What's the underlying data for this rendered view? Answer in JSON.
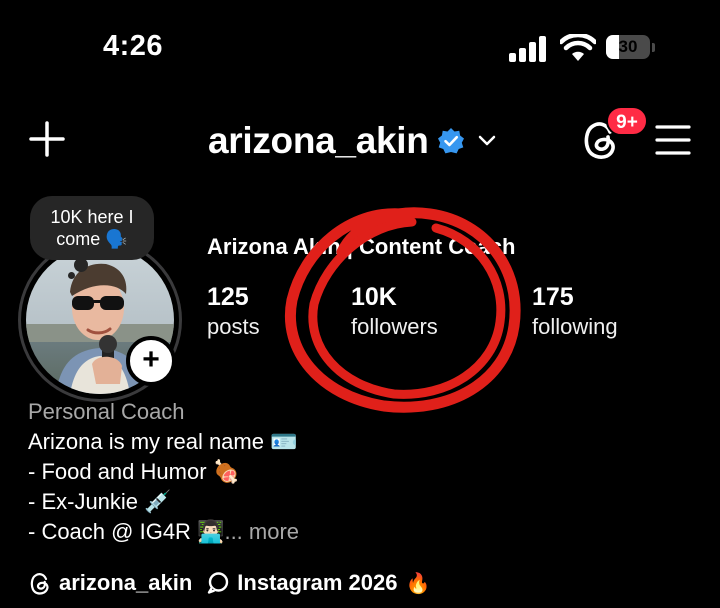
{
  "status_bar": {
    "time": "4:26",
    "battery_level": "30",
    "battery_fraction": 0.3
  },
  "header": {
    "username": "arizona_akin",
    "verified": true,
    "notification_badge": "9+",
    "icons": [
      "plus-icon",
      "verified-icon",
      "chevron-down-icon",
      "threads-icon",
      "menu-icon"
    ]
  },
  "note": {
    "text": "10K here I come 🗣️"
  },
  "profile": {
    "display_name": "Arizona Akin | Content Coach",
    "stats": {
      "posts_count": "125",
      "posts_label": "posts",
      "followers_count": "10K",
      "followers_label": "followers",
      "following_count": "175",
      "following_label": "following"
    }
  },
  "bio": {
    "category": "Personal Coach",
    "line1": "Arizona is my real name 🪪",
    "line2": "- Food and Humor 🍖",
    "line3": "- Ex-Junkie 💉",
    "line4": "- Coach @ IG4R 👨🏻‍💻",
    "ellipsis": "...",
    "more_label": "more"
  },
  "links": {
    "threads_handle": "arizona_akin",
    "channel_name": "Instagram 2026",
    "channel_emoji": "🔥"
  },
  "colors": {
    "background": "#000000",
    "text": "#ffffff",
    "secondary_text": "#a8a8a8",
    "badge": "#ff2b45",
    "verified": "#3797f0",
    "annotation_circle": "#e0201a"
  }
}
